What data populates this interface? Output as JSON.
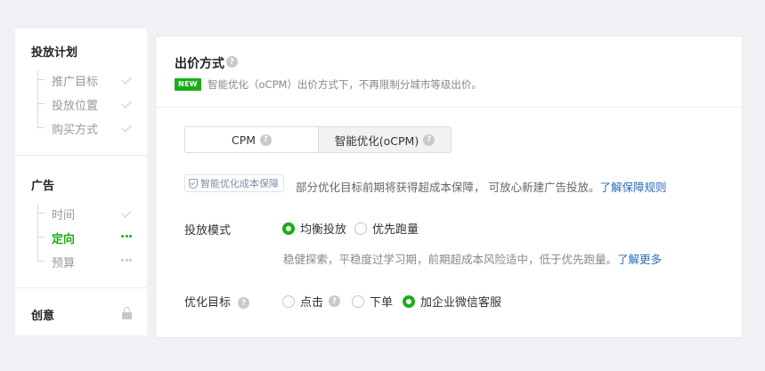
{
  "sidebar": {
    "sections": [
      {
        "title": "投放计划",
        "items": [
          {
            "label": "推广目标",
            "status": "done"
          },
          {
            "label": "投放位置",
            "status": "done"
          },
          {
            "label": "购买方式",
            "status": "done"
          }
        ]
      },
      {
        "title": "广告",
        "items": [
          {
            "label": "时间",
            "status": "done"
          },
          {
            "label": "定向",
            "status": "active"
          },
          {
            "label": "预算",
            "status": "pending"
          }
        ]
      },
      {
        "title": "创意",
        "status": "locked"
      }
    ]
  },
  "bid": {
    "title": "出价方式",
    "badge": "NEW",
    "notice": "智能优化（oCPM）出价方式下，不再限制分城市等级出价。",
    "options": [
      {
        "label": "CPM",
        "selected": false
      },
      {
        "label": "智能优化(oCPM)",
        "selected": true
      }
    ],
    "guarantee_tag": "智能优化成本保障",
    "guarantee_text": "部分优化目标前期将获得超成本保障， 可放心新建广告投放。",
    "guarantee_link": "了解保障规则"
  },
  "delivery_mode": {
    "label": "投放模式",
    "options": [
      {
        "label": "均衡投放",
        "checked": true
      },
      {
        "label": "优先跑量",
        "checked": false
      }
    ],
    "hint": "稳健探索，平稳度过学习期，前期超成本风险适中，低于优先跑量。",
    "hint_link": "了解更多"
  },
  "optimization_goal": {
    "label": "优化目标",
    "options": [
      {
        "label": "点击",
        "checked": false
      },
      {
        "label": "下单",
        "checked": false
      },
      {
        "label": "加企业微信客服",
        "checked": true
      }
    ]
  },
  "colors": {
    "accent": "#1aad19",
    "link": "#2d6bb5",
    "muted": "#999999"
  },
  "icons": {
    "help": "question-circle-icon",
    "done": "check-icon",
    "active": "dots-icon",
    "pending": "dots-icon",
    "locked": "lock-icon",
    "guarantee": "shield-check-icon"
  }
}
